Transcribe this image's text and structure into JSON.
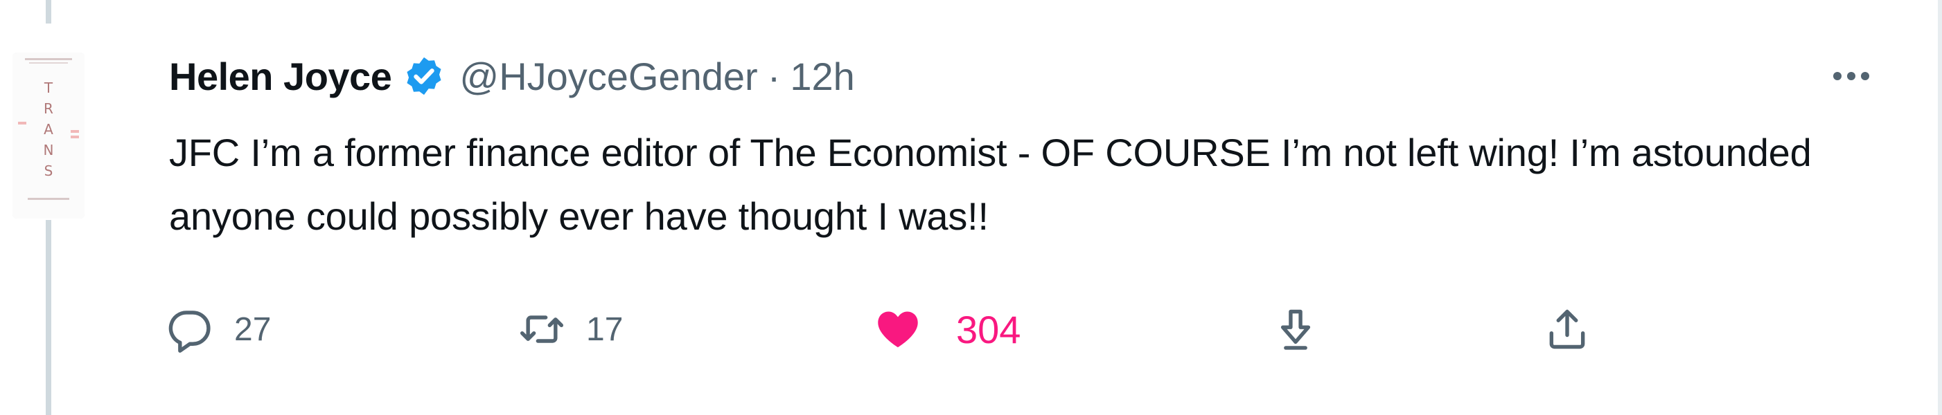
{
  "tweet": {
    "author": {
      "display_name": "Helen Joyce",
      "verified": true,
      "handle": "@HJoyceGender",
      "avatar_image": "book-cover-trans"
    },
    "separator": "·",
    "timestamp": "12h",
    "text": "JFC I’m a former finance editor of The Economist - OF COURSE I’m not left wing! I’m astounded anyone could possibly ever have thought I was!!",
    "actions": {
      "reply": {
        "icon": "reply-icon",
        "count": "27"
      },
      "retweet": {
        "icon": "retweet-icon",
        "count": "17"
      },
      "like": {
        "icon": "heart-icon",
        "count": "304",
        "liked": true
      },
      "bookmark": {
        "icon": "bookmark-download-icon"
      },
      "share": {
        "icon": "share-icon"
      }
    },
    "more_icon": "more-icon"
  },
  "avatar_lettering": [
    "T",
    "R",
    "A",
    "N",
    "S"
  ],
  "colors": {
    "text_primary": "#0f1419",
    "text_secondary": "#536471",
    "verified_blue": "#1d9bf0",
    "like_pink": "#f91880",
    "thread_line": "#cfd9de"
  }
}
